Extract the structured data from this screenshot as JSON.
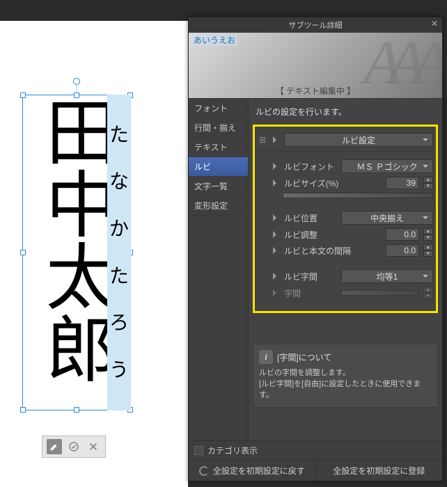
{
  "canvas": {
    "main_text": "田中太郎",
    "ruby_text": "たなかたろう"
  },
  "panel": {
    "title": "サブツール詳細",
    "preview_label": "あいうえお",
    "preview_status": "【 テキスト編集中 】",
    "description": "ルビの設定を行います。",
    "categories": [
      "フォント",
      "行間・揃え",
      "テキスト",
      "ルビ",
      "文字一覧",
      "変形設定"
    ],
    "selected_category_index": 3,
    "ruby": {
      "settings_label": "ルビ設定",
      "font_label": "ルビフォント",
      "font_value": "ＭＳ Ｐゴシック",
      "size_label": "ルビサイズ(%)",
      "size_value": "39",
      "position_label": "ルビ位置",
      "position_value": "中央揃え",
      "adjust_label": "ルビ調整",
      "adjust_value": "0.0",
      "gap_label": "ルビと本文の間隔",
      "gap_value": "0.0",
      "spacing_label": "ルビ字間",
      "spacing_value": "均等1",
      "letterspace_label": "字間"
    },
    "info": {
      "heading": "[字間]について",
      "line1": "ルビの字間を調整します。",
      "line2": "[ルビ字間]を[自由]に設定したときに使用できます。"
    },
    "footer": {
      "category_show": "カテゴリ表示",
      "reset_all": "全設定を初期設定に戻す",
      "register_all": "全設定を初期設定に登録"
    }
  }
}
